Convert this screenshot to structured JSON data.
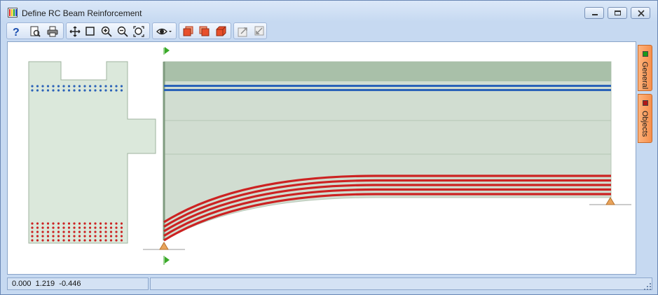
{
  "window": {
    "title": "Define RC Beam Reinforcement"
  },
  "toolbar": {
    "buttons": [
      {
        "name": "help-button",
        "icon": "help-icon"
      },
      {
        "name": "print-preview-button",
        "icon": "print-preview-icon"
      },
      {
        "name": "print-button",
        "icon": "print-icon"
      },
      {
        "name": "pan-button",
        "icon": "pan-icon"
      },
      {
        "name": "zoom-window-button",
        "icon": "zoom-window-icon"
      },
      {
        "name": "zoom-in-button",
        "icon": "zoom-in-icon"
      },
      {
        "name": "zoom-out-button",
        "icon": "zoom-out-icon"
      },
      {
        "name": "zoom-extents-button",
        "icon": "zoom-extents-icon"
      },
      {
        "name": "view-options-button",
        "icon": "eye-icon"
      },
      {
        "name": "front-view-button",
        "icon": "front-view-icon"
      },
      {
        "name": "side-view-button",
        "icon": "side-view-icon"
      },
      {
        "name": "iso-view-button",
        "icon": "iso-view-icon"
      },
      {
        "name": "export-button",
        "icon": "export-icon"
      },
      {
        "name": "import-button",
        "icon": "import-icon"
      }
    ]
  },
  "side_tabs": [
    {
      "label": "General",
      "color": "#1a9a1a"
    },
    {
      "label": "Objects",
      "color": "#b01818"
    }
  ],
  "status": {
    "coordinates": "0.000  1.219  -0.446"
  },
  "colors": {
    "concrete": "#dbe8db",
    "concrete_top": "#a9c0a9",
    "top_bars": "#2b62b8",
    "bottom_bars": "#cc2222",
    "support": "#e9a35a",
    "section_marker": "#3aaa28"
  }
}
